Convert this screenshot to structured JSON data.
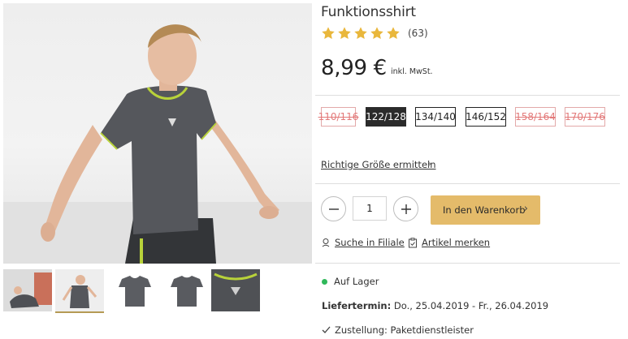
{
  "product": {
    "title": "Funktionsshirt",
    "rating": {
      "value": 5,
      "max": 5,
      "count_label": "(63)"
    },
    "price": "8,99 €",
    "price_note": "inkl. MwSt."
  },
  "colors": {
    "star": "#e9b73c",
    "accent": "#e4bb6a",
    "in_stock": "#2fb85a",
    "unavailable": "#e37a7a"
  },
  "gallery": {
    "thumbnails": [
      {
        "label": "thumbnail-1",
        "active": false
      },
      {
        "label": "thumbnail-2",
        "active": true
      },
      {
        "label": "thumbnail-3",
        "active": false
      },
      {
        "label": "thumbnail-4",
        "active": false
      },
      {
        "label": "thumbnail-5",
        "active": false
      }
    ]
  },
  "sizes": [
    {
      "label": "110/116",
      "state": "unavailable"
    },
    {
      "label": "122/128",
      "state": "selected"
    },
    {
      "label": "134/140",
      "state": "available"
    },
    {
      "label": "146/152",
      "state": "available"
    },
    {
      "label": "158/164",
      "state": "unavailable"
    },
    {
      "label": "170/176",
      "state": "unavailable"
    }
  ],
  "size_link": "Richtige Größe ermitteln",
  "quantity": {
    "value": "1",
    "minus_icon": "minus-icon",
    "plus_icon": "plus-icon"
  },
  "cart_button": "In den Warenkorb",
  "links": {
    "store_search": "Suche in Filiale",
    "wishlist": "Artikel merken"
  },
  "availability": {
    "stock": "Auf Lager",
    "delivery_label": "Liefertermin:",
    "delivery_value": "Do., 25.04.2019 - Fr., 26.04.2019",
    "shipping": "Zustellung: Paketdienstleister"
  }
}
